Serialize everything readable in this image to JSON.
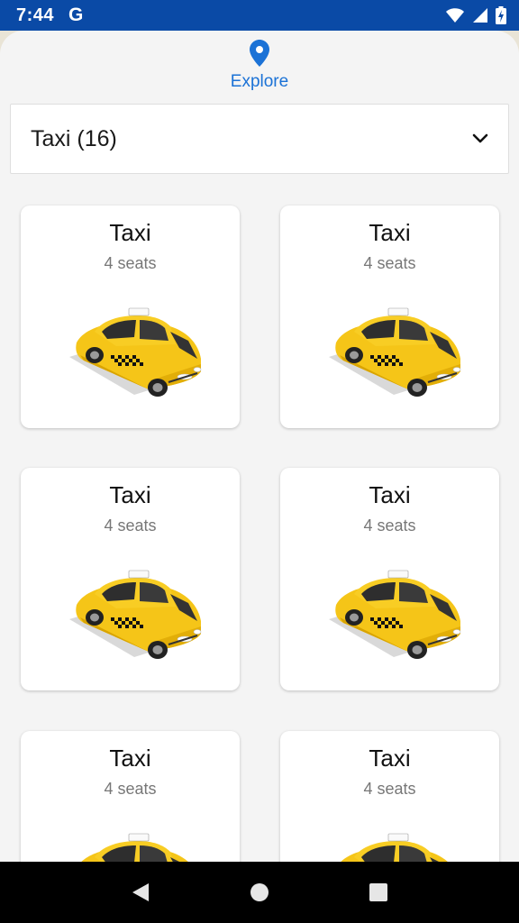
{
  "status_bar": {
    "time": "7:44",
    "google_glyph": "G",
    "icons": [
      "wifi-icon",
      "signal-icon",
      "battery-charging-icon"
    ]
  },
  "explore_tab": {
    "label": "Explore",
    "icon": "location-pin-icon",
    "color": "#1b72d6"
  },
  "category_dropdown": {
    "selected": "Taxi (16)",
    "icon": "chevron-down-icon"
  },
  "vehicles": [
    {
      "title": "Taxi",
      "seats": "4 seats",
      "image": "taxi-car-image"
    },
    {
      "title": "Taxi",
      "seats": "4 seats",
      "image": "taxi-car-image"
    },
    {
      "title": "Taxi",
      "seats": "4 seats",
      "image": "taxi-car-image"
    },
    {
      "title": "Taxi",
      "seats": "4 seats",
      "image": "taxi-car-image"
    },
    {
      "title": "Taxi",
      "seats": "4 seats",
      "image": "taxi-car-image"
    },
    {
      "title": "Taxi",
      "seats": "4 seats",
      "image": "taxi-car-image"
    }
  ],
  "nav_bar": {
    "buttons": [
      "back-icon",
      "home-icon",
      "recents-icon"
    ]
  },
  "colors": {
    "status_bar": "#0a4aa6",
    "taxi_yellow": "#f5c518",
    "sheet_background": "#f4f4f4"
  }
}
